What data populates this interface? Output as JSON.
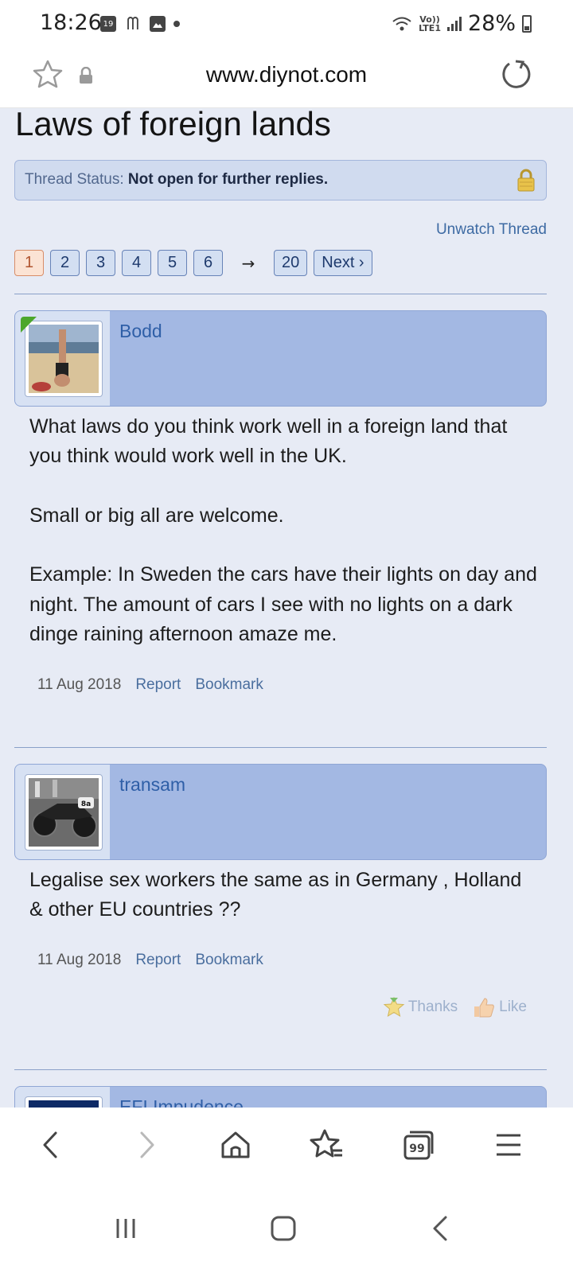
{
  "status_bar": {
    "time": "18:26",
    "calendar_badge": "19",
    "network_label_top": "Vo))",
    "network_label_bottom": "LTE1",
    "battery_percent": "28%"
  },
  "address_bar": {
    "url": "www.diynot.com"
  },
  "thread": {
    "title": "Laws of foreign lands",
    "status_label": "Thread Status:",
    "status_value": "Not open for further replies.",
    "unwatch": "Unwatch Thread",
    "pages": [
      "1",
      "2",
      "3",
      "4",
      "5",
      "6"
    ],
    "current_page": "1",
    "arrow": "→",
    "last_page": "20",
    "next": "Next ›"
  },
  "posts": [
    {
      "username": "Bodd",
      "body": [
        "What laws do you think work well in a foreign land that you think would work well in the UK.",
        "Small or big all are welcome.",
        "Example: In Sweden the cars have their lights on day and night. The amount of cars I see with no lights on a dark dinge raining afternoon amaze me."
      ],
      "date": "11 Aug 2018",
      "report": "Report",
      "bookmark": "Bookmark"
    },
    {
      "username": "transam",
      "body": [
        "Legalise sex workers the same as in Germany , Holland & other EU countries ??"
      ],
      "date": "11 Aug 2018",
      "report": "Report",
      "bookmark": "Bookmark",
      "thanks": "Thanks",
      "like": "Like"
    },
    {
      "username": "EFI Impudence"
    }
  ],
  "colors": {
    "page_bg": "#e7ebf5",
    "post_header_bg": "#a3b8e3",
    "username": "#2f5fa7",
    "current_page_bg": "#fbe3d4"
  },
  "icons": {
    "address_bar": [
      "star-icon",
      "lock-icon",
      "reload-icon"
    ],
    "toolbar": [
      "back-icon",
      "forward-icon",
      "home-icon",
      "bookmarks-icon",
      "tabs-icon",
      "menu-icon"
    ],
    "tabs_count": "99",
    "system_nav": [
      "recents-icon",
      "home-nav-icon",
      "back-nav-icon"
    ]
  }
}
